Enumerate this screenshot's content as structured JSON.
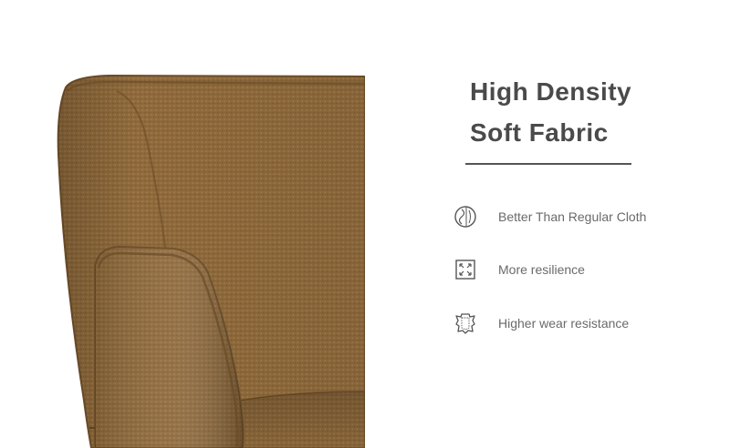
{
  "heading": {
    "line1": "High Density",
    "line2": "Soft Fabric"
  },
  "features": [
    {
      "icon": "fabric-swatch-icon",
      "label": "Better Than Regular Cloth"
    },
    {
      "icon": "resilience-arrows-icon",
      "label": "More resilience"
    },
    {
      "icon": "leather-hide-icon",
      "label": "Higher wear resistance"
    }
  ],
  "colors": {
    "fabric": "#8f6a3c",
    "heading": "#4a4a4a",
    "text": "#6a6a6a"
  }
}
